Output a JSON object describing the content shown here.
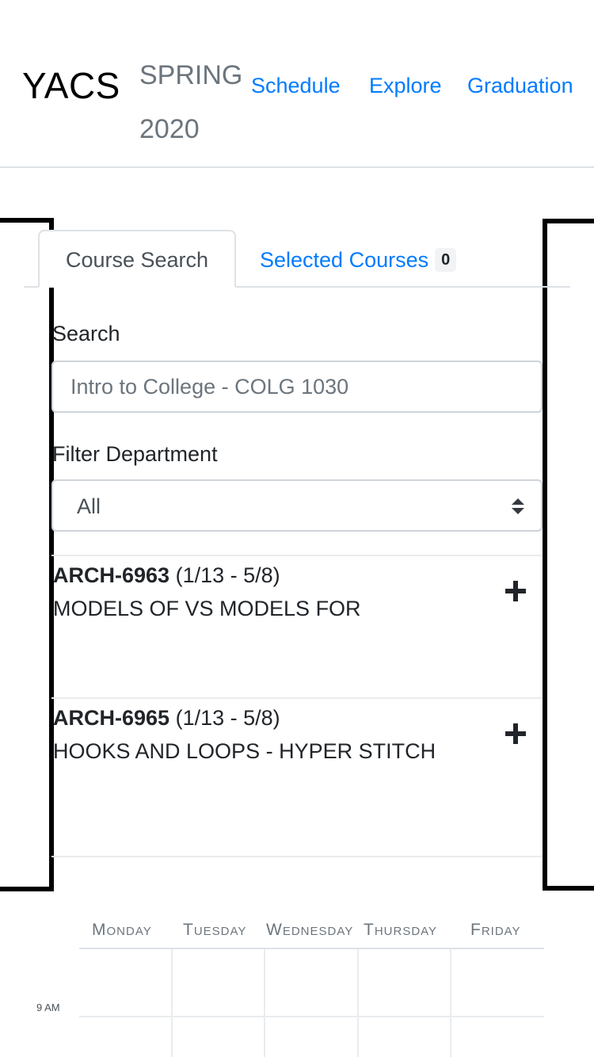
{
  "header": {
    "brand": "YACS",
    "semester_line1": "SPRING",
    "semester_line2": "2020",
    "nav": {
      "schedule": "Schedule",
      "explore": "Explore",
      "graduation": "Graduation"
    }
  },
  "tabs": {
    "course_search": "Course Search",
    "selected_courses": "Selected Courses",
    "selected_count": "0"
  },
  "search": {
    "label": "Search",
    "placeholder": "Intro to College - COLG 1030",
    "value": ""
  },
  "filter": {
    "label": "Filter Department",
    "selected": "All"
  },
  "courses": [
    {
      "code": "ARCH-6963",
      "dates": "(1/13 - 5/8)",
      "title": "MODELS OF VS MODELS FOR"
    },
    {
      "code": "ARCH-6965",
      "dates": "(1/13 - 5/8)",
      "title": "HOOKS AND LOOPS - HYPER STITCH"
    }
  ],
  "calendar": {
    "days": [
      "Monday",
      "Tuesday",
      "Wednesday",
      "Thursday",
      "Friday"
    ],
    "times": [
      "9 AM"
    ]
  },
  "colors": {
    "link": "#007bff",
    "muted": "#6c757d",
    "border": "#dee2e6",
    "frame": "#000000"
  }
}
